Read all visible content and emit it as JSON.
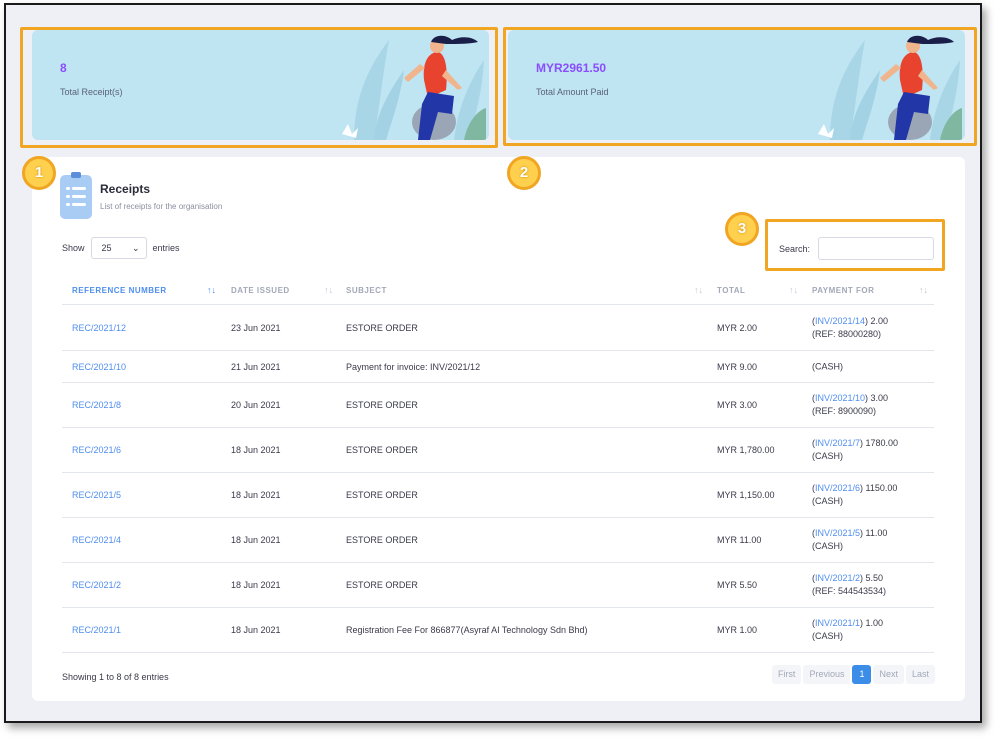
{
  "cards": [
    {
      "value": "8",
      "label": "Total Receipt(s)"
    },
    {
      "value": "MYR2961.50",
      "label": "Total Amount Paid"
    }
  ],
  "callouts": [
    "1",
    "2",
    "3"
  ],
  "panel": {
    "title": "Receipts",
    "subtitle": "List of receipts for the organisation",
    "show_label": "Show",
    "page_length": "25",
    "entries_label": "entries",
    "search_label": "Search:",
    "search_value": ""
  },
  "table": {
    "columns": [
      "REFERENCE NUMBER",
      "DATE ISSUED",
      "SUBJECT",
      "TOTAL",
      "PAYMENT FOR"
    ],
    "rows": [
      {
        "ref": "REC/2021/12",
        "date": "23 Jun 2021",
        "subject": "ESTORE ORDER",
        "total": "MYR 2.00",
        "pay_inv": "INV/2021/14",
        "pay_amount": "2.00",
        "pay_note": "(REF: 88000280)"
      },
      {
        "ref": "REC/2021/10",
        "date": "21 Jun 2021",
        "subject": "Payment for invoice: INV/2021/12",
        "total": "MYR 9.00",
        "pay_inv": "",
        "pay_amount": "",
        "pay_note": "(CASH)"
      },
      {
        "ref": "REC/2021/8",
        "date": "20 Jun 2021",
        "subject": "ESTORE ORDER",
        "total": "MYR 3.00",
        "pay_inv": "INV/2021/10",
        "pay_amount": "3.00",
        "pay_note": "(REF: 8900090)"
      },
      {
        "ref": "REC/2021/6",
        "date": "18 Jun 2021",
        "subject": "ESTORE ORDER",
        "total": "MYR 1,780.00",
        "pay_inv": "INV/2021/7",
        "pay_amount": "1780.00",
        "pay_note": "(CASH)"
      },
      {
        "ref": "REC/2021/5",
        "date": "18 Jun 2021",
        "subject": "ESTORE ORDER",
        "total": "MYR 1,150.00",
        "pay_inv": "INV/2021/6",
        "pay_amount": "1150.00",
        "pay_note": "(CASH)"
      },
      {
        "ref": "REC/2021/4",
        "date": "18 Jun 2021",
        "subject": "ESTORE ORDER",
        "total": "MYR 11.00",
        "pay_inv": "INV/2021/5",
        "pay_amount": "11.00",
        "pay_note": "(CASH)"
      },
      {
        "ref": "REC/2021/2",
        "date": "18 Jun 2021",
        "subject": "ESTORE ORDER",
        "total": "MYR 5.50",
        "pay_inv": "INV/2021/2",
        "pay_amount": "5.50",
        "pay_note": "(REF: 544543534)"
      },
      {
        "ref": "REC/2021/1",
        "date": "18 Jun 2021",
        "subject": "Registration Fee For 866877(Asyraf AI Technology Sdn Bhd)",
        "total": "MYR 1.00",
        "pay_inv": "INV/2021/1",
        "pay_amount": "1.00",
        "pay_note": "(CASH)"
      }
    ]
  },
  "footer": {
    "info": "Showing 1 to 8 of 8 entries",
    "pager": {
      "first": "First",
      "previous": "Previous",
      "current": "1",
      "next": "Next",
      "last": "Last"
    }
  },
  "icons": {
    "sort": "sort-arrows-icon",
    "receipt": "clipboard-list-icon",
    "select": "chevron-down-icon"
  },
  "colors": {
    "accent": "#4f8ef0",
    "highlight": "#f0a523",
    "card_bg": "#bfe4f2",
    "stat_value": "#8a4dff"
  }
}
